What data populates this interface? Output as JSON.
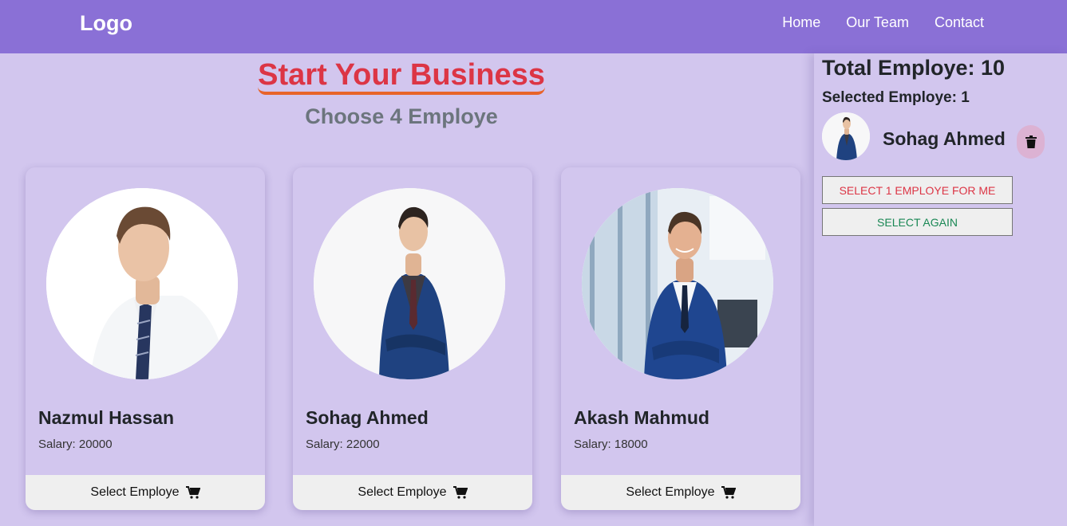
{
  "navbar": {
    "logo": "Logo",
    "links": [
      "Home",
      "Our Team",
      "Contact"
    ]
  },
  "hero": {
    "title": "Start Your Business",
    "subtitle": "Choose 4 Employe"
  },
  "employees": [
    {
      "name": "Nazmul Hassan",
      "salary": "Salary: 20000",
      "button": "Select Employe",
      "icon": "cart-icon"
    },
    {
      "name": "Sohag Ahmed",
      "salary": "Salary: 22000",
      "button": "Select Employe",
      "icon": "cart-icon"
    },
    {
      "name": "Akash Mahmud",
      "salary": "Salary: 18000",
      "button": "Select Employe",
      "icon": "cart-icon"
    }
  ],
  "sidebar": {
    "total": "Total Employe: 10",
    "selected": "Selected Employe: 1",
    "selected_list": [
      {
        "name": "Sohag Ahmed",
        "icon": "trash-icon"
      }
    ],
    "select_one_button": "SELECT 1 EMPLOYE FOR ME",
    "select_again_button": "SELECT AGAIN"
  },
  "colors": {
    "navbar": "#8a70d6",
    "background": "#d2c6ee",
    "title": "#dc3545",
    "title_underline": "#e8642a",
    "subtitle": "#6c757d",
    "trash_button": "#dcb2d3",
    "select_one_text": "#dc3545",
    "select_again_text": "#198754"
  }
}
